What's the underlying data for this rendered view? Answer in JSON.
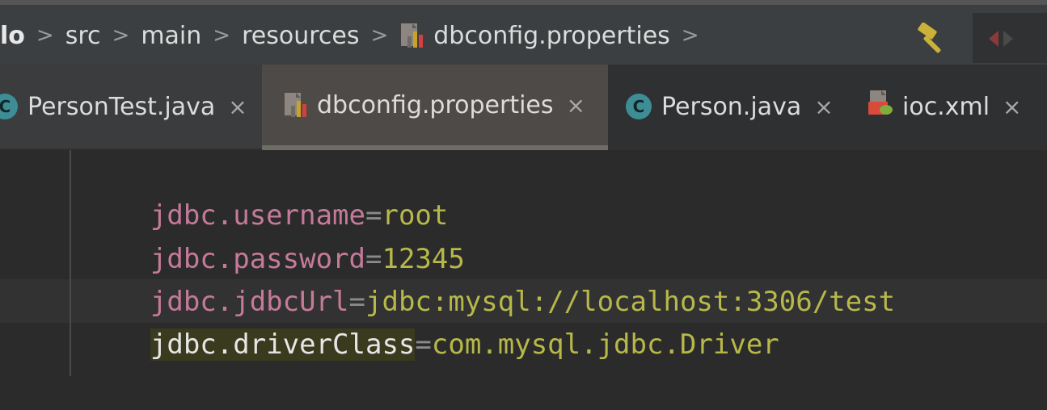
{
  "breadcrumb": {
    "items": [
      "lo",
      "src",
      "main",
      "resources",
      "dbconfig.properties"
    ],
    "separator": ">"
  },
  "tabs": [
    {
      "label": "PersonTest.java",
      "icon": "java-class-icon",
      "close": "×"
    },
    {
      "label": "dbconfig.properties",
      "icon": "properties-file-icon",
      "close": "×",
      "active": true
    },
    {
      "label": "Person.java",
      "icon": "java-class-icon",
      "close": "×"
    },
    {
      "label": "ioc.xml",
      "icon": "spring-xml-icon",
      "close": "×"
    }
  ],
  "class_icon_letter": "C",
  "editor": {
    "lines": [
      {
        "key": "jdbc.username",
        "eq": "=",
        "value": "root"
      },
      {
        "key": "jdbc.password",
        "eq": "=",
        "value": "12345"
      },
      {
        "key": "jdbc.jdbcUrl",
        "eq": "=",
        "value": "jdbc:mysql://localhost:3306/test"
      },
      {
        "key": "jdbc.driverClass",
        "eq": "=",
        "value": "com.mysql.jdbc.Driver"
      }
    ]
  },
  "colors": {
    "key": "#c67a9a",
    "value": "#b8b84a",
    "background": "#2b2b2b",
    "active_tab": "#4e4a47"
  }
}
